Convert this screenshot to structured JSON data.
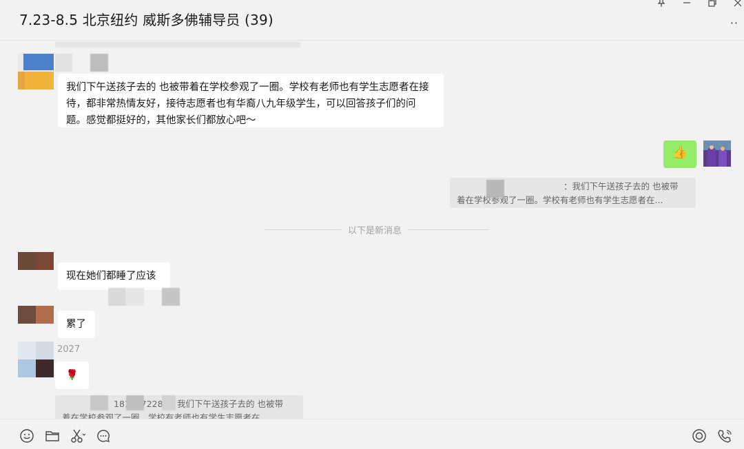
{
  "window": {
    "title": "7.23-8.5 北京纽约 威斯多佛辅导员 (39)",
    "more_label": "··"
  },
  "messages": {
    "msg1_text": "我们下午送孩子去的 也被带着在学校参观了一圈。学校有老师也有学生志愿者在接待，都非常热情友好，接待志愿者也有华裔八九年级学生，可以回答孩子们的问题。感觉都挺好的，其他家长们都放心吧～",
    "reply_thumbs": "👍",
    "quote1_line1": "：我们下午送孩子去的 也被带",
    "quote1_line2": "着在学校参观了一圈。学校有老师也有学生志愿者在...",
    "divider_label": "以下是新消息",
    "msg2_text": "现在她们都睡了应该",
    "msg3_text": "累了",
    "sender4_suffix": "2027",
    "msg4_text": "🌹",
    "quote2_line1": "1810172289：我们下午送孩子去的 也被带",
    "quote2_line2": "着在学校参观了一圈。学校有老师也有学生志愿者在"
  },
  "toolbar": {
    "icons": [
      "emoji-icon",
      "folder-icon",
      "scissors-icon",
      "chat-history-icon",
      "live-icon",
      "call-icon"
    ]
  },
  "colors": {
    "bubble_self": "#95ec69",
    "bubble_other": "#ffffff",
    "background": "#f2f2f2"
  }
}
